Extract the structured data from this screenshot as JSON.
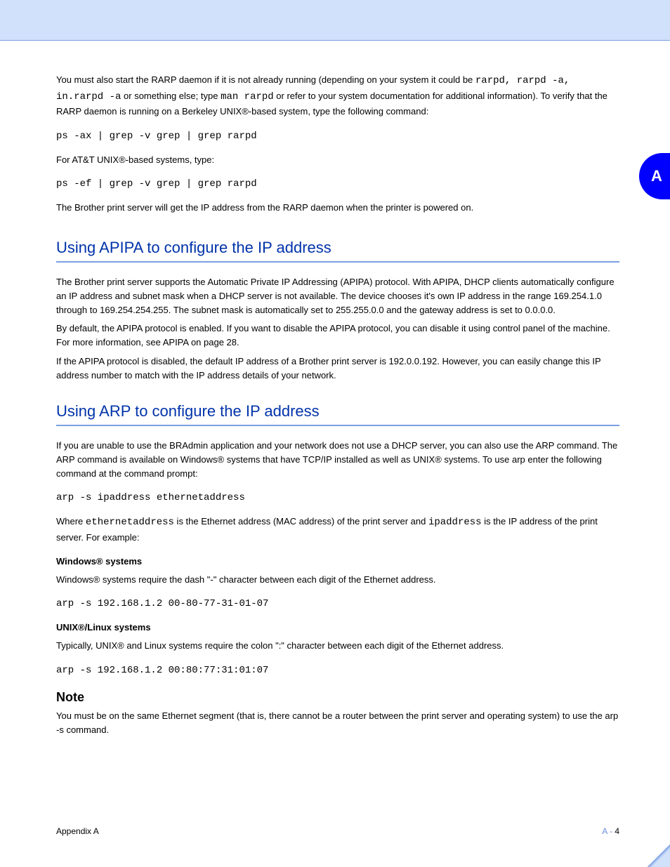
{
  "sidetab": "A",
  "p1_pre": "You must also start the RARP daemon if it is not already running (depending on your system it could be ",
  "p1_code1": "rarpd, rarpd -a, in.rarpd -a",
  "p1_mid1": " or something else; type ",
  "p1_code2": "man rarpd",
  "p1_mid2": " or refer to your system documentation for additional information). To verify that the RARP daemon is running on a Berkeley UNIX®-based system, type the following command:",
  "cmd1": "ps -ax | grep -v grep | grep rarpd",
  "p2": "For AT&T UNIX®-based systems, type:",
  "cmd2": "ps -ef | grep -v grep | grep rarpd",
  "p3": "The Brother print server will get the IP address from the RARP daemon when the printer is powered on.",
  "h2a": "Using APIPA to configure the IP address",
  "pA1": "The Brother print server supports the Automatic Private IP Addressing (APIPA) protocol. With APIPA, DHCP clients automatically configure an IP address and subnet mask when a DHCP server is not available. The device chooses it's own IP address in the range 169.254.1.0 through to 169.254.254.255. The subnet mask is automatically set to 255.255.0.0 and the gateway address is set to 0.0.0.0.",
  "pA2": "By default, the APIPA protocol is enabled. If you want to disable the APIPA protocol, you can disable it using control panel of the machine. For more information, see APIPA on page 28.",
  "pA3": "If the APIPA protocol is disabled, the default IP address of a Brother print server is 192.0.0.192. However, you can easily change this IP address number to match with the IP address details of your network.",
  "h2b": "Using ARP to configure the IP address",
  "pB1": "If you are unable to use the BRAdmin application and your network does not use a DHCP server, you can also use the ARP command. The ARP command is available on Windows® systems that have TCP/IP installed as well as UNIX® systems. To use arp enter the following command at the command prompt:",
  "cmdB": "arp -s ipaddress ethernetaddress",
  "pB2_pre": "Where ",
  "pB2_c1": "ethernetaddress",
  "pB2_mid": " is the Ethernet address (MAC address) of the print server and ",
  "pB2_c2": "ipaddress",
  "pB2_post": " is the IP address of the print server. For example:",
  "winHdr": "Windows® systems",
  "pW1": "Windows® systems require the dash \"-\" character between each digit of the Ethernet address.",
  "cmdW": "arp -s 192.168.1.2 00-80-77-31-01-07",
  "unixHdr": "UNIX®/Linux systems",
  "pU1": "Typically, UNIX® and Linux systems require the colon \":\" character between each digit of the Ethernet address.",
  "cmdU": "arp -s 192.168.1.2 00:80:77:31:01:07",
  "noteLabel": "Note",
  "noteText": "You must be on the same Ethernet segment (that is, there cannot be a router between the print server and operating system) to use the arp -s command.",
  "footerLeft": "Appendix A",
  "footerRight_prefix": "A - ",
  "footerRight_num": "4"
}
